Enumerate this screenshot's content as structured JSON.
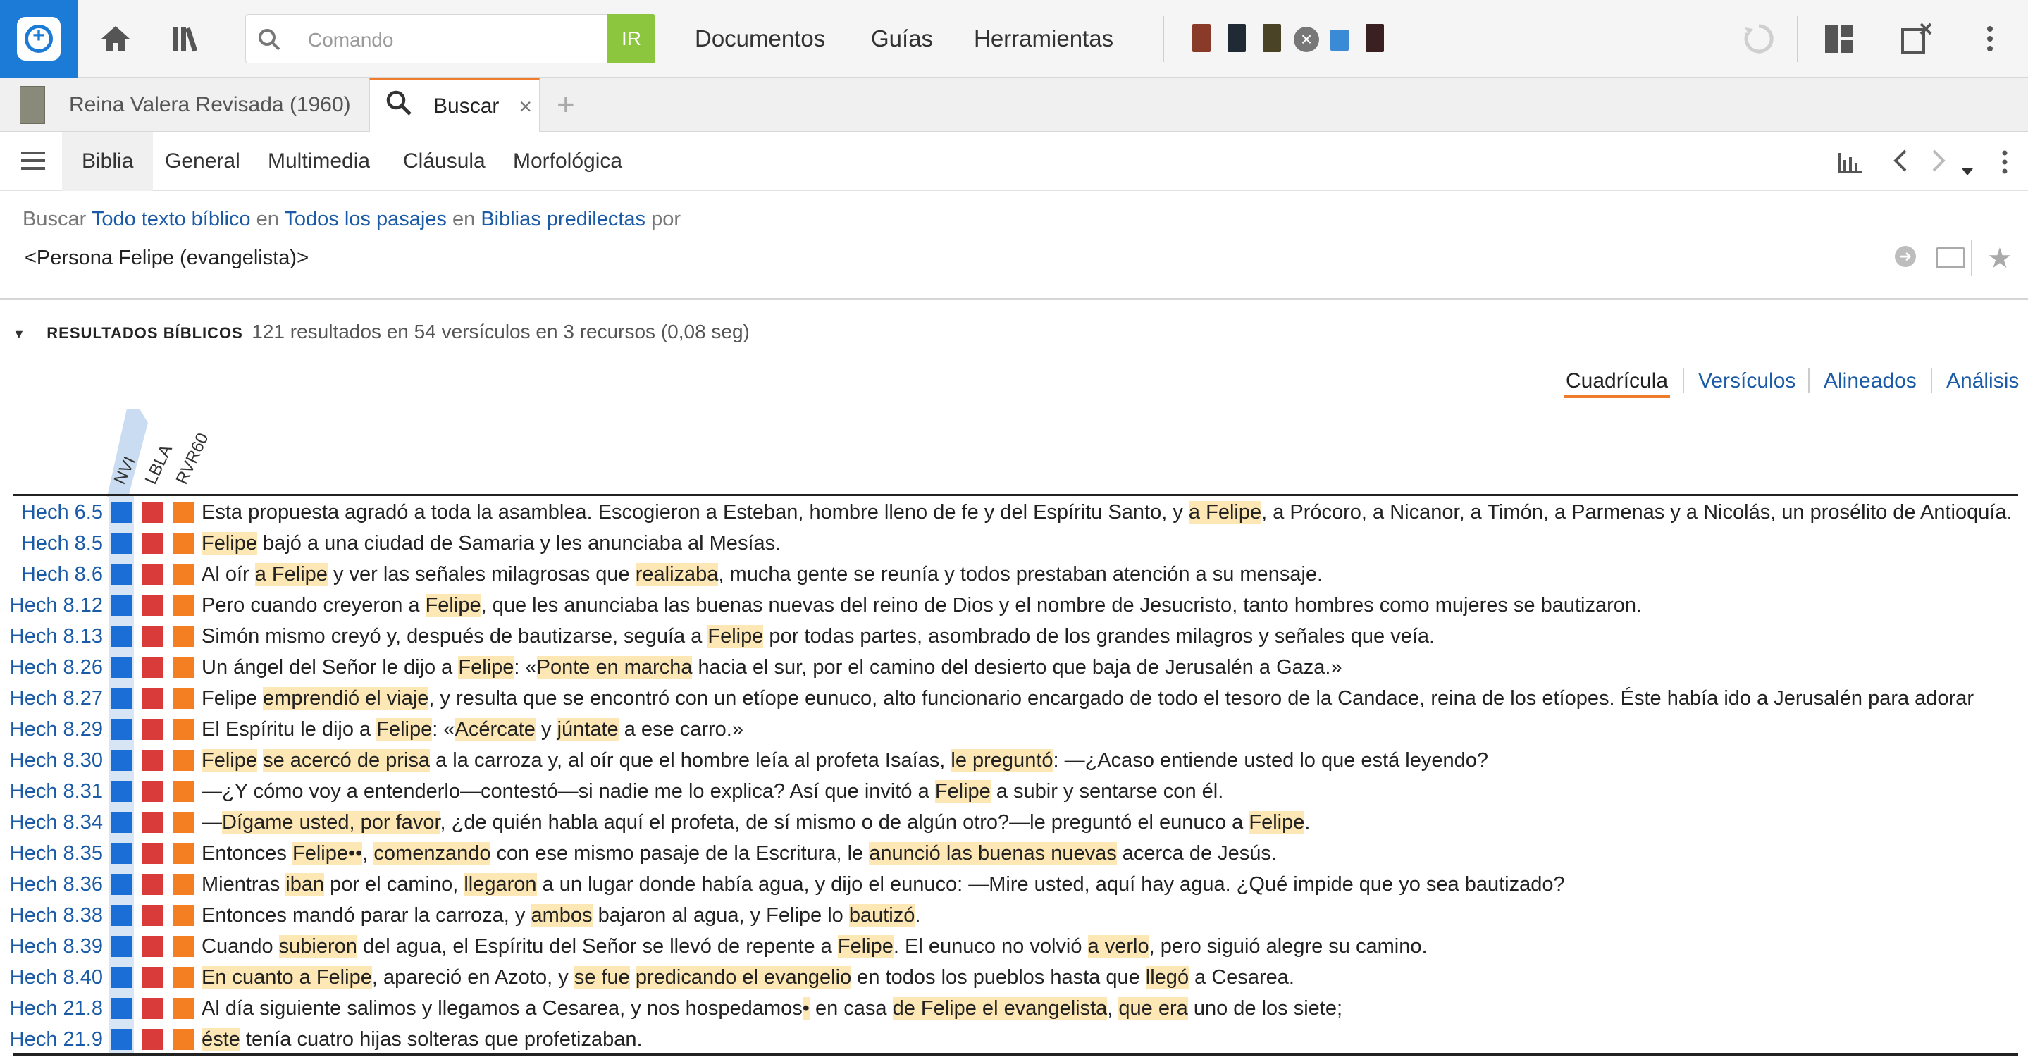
{
  "toolbar": {
    "command_placeholder": "Comando",
    "go_label": "IR",
    "menu": [
      "Documentos",
      "Guías",
      "Herramientas"
    ],
    "resource_icons": [
      "#8a3a28",
      "#1f2a35",
      "#4a4325",
      "#3a8ad6",
      "#3a2020"
    ]
  },
  "tabs": {
    "tab1_label": "Reina Valera Revisada (1960)",
    "tab2_label": "Buscar",
    "close": "×",
    "add": "+"
  },
  "subnav": {
    "items": [
      "Biblia",
      "General",
      "Multimedia",
      "Cláusula",
      "Morfológica"
    ]
  },
  "search": {
    "prefix": "Buscar",
    "scope": "Todo texto bíblico",
    "in1": "en",
    "passages": "Todos los pasajes",
    "in2": "en",
    "bibles": "Biblias predilectas",
    "by": "por",
    "query": "<Persona Felipe (evangelista)>"
  },
  "results": {
    "title": "RESULTADOS BÍBLICOS",
    "stats": "121 resultados en 54 versículos en 3 recursos (0,08 seg)",
    "views": [
      "Cuadrícula",
      "Versículos",
      "Alineados",
      "Análisis"
    ],
    "columns": [
      "NVI",
      "LBLA",
      "RVR60"
    ],
    "colors": {
      "nvi": "#1b6ed6",
      "lbla": "#d93a3a",
      "rvr60": "#f47f22",
      "highlight": "#fde7b5"
    },
    "rows": [
      {
        "ref": "Hech 6.5",
        "segs": [
          [
            "Esta propuesta agradó a toda la asamblea. Escogieron a Esteban, hombre lleno de fe y del Espíritu Santo, y ",
            0
          ],
          [
            "a Felipe",
            1
          ],
          [
            ", a Prócoro, a Nicanor, a Timón, a Parmenas y a Nicolás, un prosélito de Antioquía.",
            0
          ]
        ]
      },
      {
        "ref": "Hech 8.5",
        "segs": [
          [
            "Felipe",
            1
          ],
          [
            " bajó a una ciudad de Samaria y les anunciaba al Mesías.",
            0
          ]
        ]
      },
      {
        "ref": "Hech 8.6",
        "segs": [
          [
            "Al oír ",
            0
          ],
          [
            "a Felipe",
            1
          ],
          [
            " y ver las señales milagrosas que ",
            0
          ],
          [
            "realizaba",
            1
          ],
          [
            ", mucha gente se reunía y todos prestaban atención a su mensaje.",
            0
          ]
        ]
      },
      {
        "ref": "Hech 8.12",
        "segs": [
          [
            "Pero cuando creyeron a ",
            0
          ],
          [
            "Felipe",
            1
          ],
          [
            ", que les anunciaba las buenas nuevas del reino de Dios y el nombre de Jesucristo, tanto hombres como mujeres se bautizaron.",
            0
          ]
        ]
      },
      {
        "ref": "Hech 8.13",
        "segs": [
          [
            "Simón mismo creyó y, después de bautizarse, seguía a ",
            0
          ],
          [
            "Felipe",
            1
          ],
          [
            " por todas partes, asombrado de los grandes milagros y señales que veía.",
            0
          ]
        ]
      },
      {
        "ref": "Hech 8.26",
        "segs": [
          [
            "Un ángel del Señor le dijo a ",
            0
          ],
          [
            "Felipe",
            1
          ],
          [
            ": «",
            0
          ],
          [
            "Ponte en marcha",
            1
          ],
          [
            " hacia el sur, por el camino del desierto que baja de Jerusalén a Gaza.»",
            0
          ]
        ]
      },
      {
        "ref": "Hech 8.27",
        "segs": [
          [
            "Felipe ",
            0
          ],
          [
            "emprendió el viaje",
            1
          ],
          [
            ", y resulta que se encontró con un etíope eunuco, alto funcionario encargado de todo el tesoro de la Candace, reina de los etíopes. Éste había ido a Jerusalén para adorar",
            0
          ]
        ]
      },
      {
        "ref": "Hech 8.29",
        "segs": [
          [
            "El Espíritu le dijo a ",
            0
          ],
          [
            "Felipe",
            1
          ],
          [
            ": «",
            0
          ],
          [
            "Acércate",
            1
          ],
          [
            " y ",
            0
          ],
          [
            "júntate",
            1
          ],
          [
            " a ese carro.»",
            0
          ]
        ]
      },
      {
        "ref": "Hech 8.30",
        "segs": [
          [
            "Felipe",
            1
          ],
          [
            " ",
            0
          ],
          [
            "se acercó de prisa",
            1
          ],
          [
            " a la carroza y, al oír que el hombre leía al profeta Isaías, ",
            0
          ],
          [
            "le preguntó",
            1
          ],
          [
            ": —¿Acaso entiende usted lo que está leyendo?",
            0
          ]
        ]
      },
      {
        "ref": "Hech 8.31",
        "segs": [
          [
            "—¿Y cómo voy a entenderlo—contestó—si nadie me lo explica? Así que invitó a ",
            0
          ],
          [
            "Felipe",
            1
          ],
          [
            " a subir y sentarse con él.",
            0
          ]
        ]
      },
      {
        "ref": "Hech 8.34",
        "segs": [
          [
            "—",
            0
          ],
          [
            "Dígame usted, por favor",
            1
          ],
          [
            ", ¿de quién habla aquí el profeta, de sí mismo o de algún otro?—le preguntó el eunuco a ",
            0
          ],
          [
            "Felipe",
            1
          ],
          [
            ".",
            0
          ]
        ]
      },
      {
        "ref": "Hech 8.35",
        "segs": [
          [
            "Entonces ",
            0
          ],
          [
            "Felipe••",
            1
          ],
          [
            ", ",
            0
          ],
          [
            "comenzando",
            1
          ],
          [
            " con ese mismo pasaje de la Escritura, le ",
            0
          ],
          [
            "anunció las buenas nuevas",
            1
          ],
          [
            " acerca de Jesús.",
            0
          ]
        ]
      },
      {
        "ref": "Hech 8.36",
        "segs": [
          [
            "Mientras ",
            0
          ],
          [
            "iban",
            1
          ],
          [
            " por el camino, ",
            0
          ],
          [
            "llegaron",
            1
          ],
          [
            " a un lugar donde había agua, y dijo el eunuco: —Mire usted, aquí hay agua. ¿Qué impide que yo sea bautizado?",
            0
          ]
        ]
      },
      {
        "ref": "Hech 8.38",
        "segs": [
          [
            "Entonces mandó parar la carroza, y ",
            0
          ],
          [
            "ambos",
            1
          ],
          [
            " bajaron al agua, y Felipe lo ",
            0
          ],
          [
            "bautizó",
            1
          ],
          [
            ".",
            0
          ]
        ]
      },
      {
        "ref": "Hech 8.39",
        "segs": [
          [
            "Cuando ",
            0
          ],
          [
            "subieron",
            1
          ],
          [
            " del agua, el Espíritu del Señor se llevó de repente a ",
            0
          ],
          [
            "Felipe",
            1
          ],
          [
            ". El eunuco no volvió ",
            0
          ],
          [
            "a verlo",
            1
          ],
          [
            ", pero siguió alegre su camino.",
            0
          ]
        ]
      },
      {
        "ref": "Hech 8.40",
        "segs": [
          [
            "En cuanto a Felipe",
            1
          ],
          [
            ", apareció en Azoto, y ",
            0
          ],
          [
            "se fue",
            1
          ],
          [
            " ",
            0
          ],
          [
            "predicando el evangelio",
            1
          ],
          [
            " en todos los pueblos hasta que ",
            0
          ],
          [
            "llegó",
            1
          ],
          [
            " a Cesarea.",
            0
          ]
        ]
      },
      {
        "ref": "Hech 21.8",
        "segs": [
          [
            "Al día siguiente salimos y llegamos a Cesarea, y nos hospedamos",
            0
          ],
          [
            "•",
            1
          ],
          [
            " en casa ",
            0
          ],
          [
            "de Felipe el evangelista",
            1
          ],
          [
            ", ",
            0
          ],
          [
            "que era",
            1
          ],
          [
            " uno de los siete;",
            0
          ]
        ]
      },
      {
        "ref": "Hech 21.9",
        "segs": [
          [
            "éste",
            1
          ],
          [
            " tenía cuatro hijas solteras que profetizaban.",
            0
          ]
        ]
      }
    ]
  }
}
